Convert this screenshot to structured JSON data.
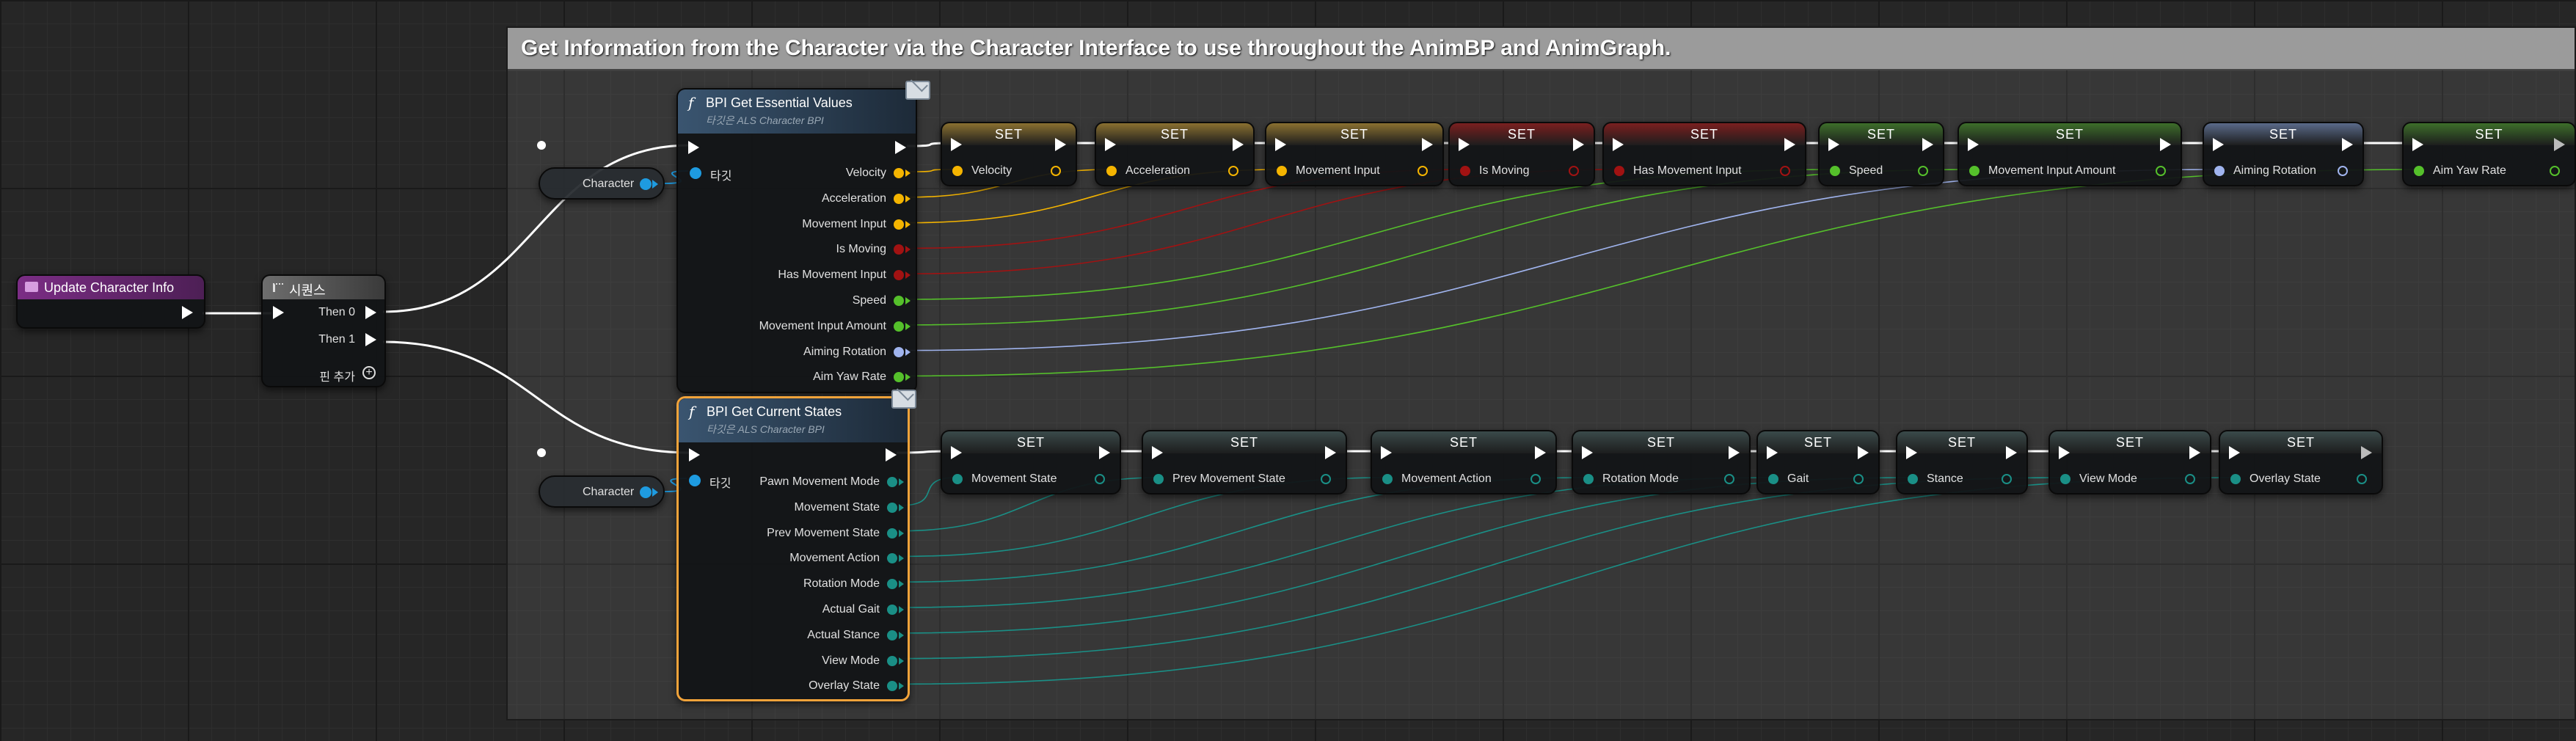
{
  "comment": {
    "title": "Get Information from the Character via the Character Interface to use throughout the AnimBP and AnimGraph."
  },
  "event_node": {
    "title": "Update Character Info"
  },
  "sequence_node": {
    "title": "시퀀스",
    "then0": "Then 0",
    "then1": "Then 1",
    "add_pin": "핀 추가"
  },
  "character_refs": [
    {
      "label": "Character"
    },
    {
      "label": "Character"
    }
  ],
  "essential_values": {
    "title": "BPI Get Essential Values",
    "subtitle": "타깃은 ALS Character BPI",
    "target_label": "타깃",
    "outputs": [
      {
        "label": "Velocity",
        "color": "#f4b400"
      },
      {
        "label": "Acceleration",
        "color": "#f4b400"
      },
      {
        "label": "Movement Input",
        "color": "#f4b400"
      },
      {
        "label": "Is Moving",
        "color": "#a11212"
      },
      {
        "label": "Has Movement Input",
        "color": "#a11212"
      },
      {
        "label": "Speed",
        "color": "#55c02b"
      },
      {
        "label": "Movement Input Amount",
        "color": "#55c02b"
      },
      {
        "label": "Aiming Rotation",
        "color": "#a0b4ee"
      },
      {
        "label": "Aim Yaw Rate",
        "color": "#55c02b"
      }
    ]
  },
  "current_states": {
    "title": "BPI Get Current States",
    "subtitle": "타깃은 ALS Character BPI",
    "target_label": "타깃",
    "outputs": [
      {
        "label": "Pawn Movement Mode",
        "color": "#1a8f86"
      },
      {
        "label": "Movement State",
        "color": "#1a8f86"
      },
      {
        "label": "Prev Movement State",
        "color": "#1a8f86"
      },
      {
        "label": "Movement Action",
        "color": "#1a8f86"
      },
      {
        "label": "Rotation Mode",
        "color": "#1a8f86"
      },
      {
        "label": "Actual Gait",
        "color": "#1a8f86"
      },
      {
        "label": "Actual Stance",
        "color": "#1a8f86"
      },
      {
        "label": "View Mode",
        "color": "#1a8f86"
      },
      {
        "label": "Overlay State",
        "color": "#1a8f86"
      }
    ]
  },
  "set_title": "SET",
  "set_row1": [
    {
      "label": "Velocity",
      "color": "#f4b400",
      "header": "#8a7030"
    },
    {
      "label": "Acceleration",
      "color": "#f4b400",
      "header": "#8a7030"
    },
    {
      "label": "Movement Input",
      "color": "#f4b400",
      "header": "#8a7030"
    },
    {
      "label": "Is Moving",
      "color": "#a11212",
      "header": "#7a1f1f"
    },
    {
      "label": "Has Movement Input",
      "color": "#a11212",
      "header": "#7a1f1f"
    },
    {
      "label": "Speed",
      "color": "#55c02b",
      "header": "#3d6e2a"
    },
    {
      "label": "Movement Input Amount",
      "color": "#55c02b",
      "header": "#3d6e2a"
    },
    {
      "label": "Aiming Rotation",
      "color": "#a0b4ee",
      "header": "#5a6a8a"
    },
    {
      "label": "Aim Yaw Rate",
      "color": "#55c02b",
      "header": "#3d6e2a"
    }
  ],
  "set_row2": [
    {
      "label": "Movement State",
      "color": "#1a8f86",
      "header": "#3a4a4a"
    },
    {
      "label": "Prev Movement State",
      "color": "#1a8f86",
      "header": "#3a4a4a"
    },
    {
      "label": "Movement Action",
      "color": "#1a8f86",
      "header": "#3a4a4a"
    },
    {
      "label": "Rotation Mode",
      "color": "#1a8f86",
      "header": "#3a4a4a"
    },
    {
      "label": "Gait",
      "color": "#1a8f86",
      "header": "#3a4a4a"
    },
    {
      "label": "Stance",
      "color": "#1a8f86",
      "header": "#3a4a4a"
    },
    {
      "label": "View Mode",
      "color": "#1a8f86",
      "header": "#3a4a4a"
    },
    {
      "label": "Overlay State",
      "color": "#1a8f86",
      "header": "#3a4a4a"
    }
  ],
  "colors": {
    "exec": "#ffffff",
    "object": "#1e9be0",
    "event_header": "#7b2d85"
  }
}
